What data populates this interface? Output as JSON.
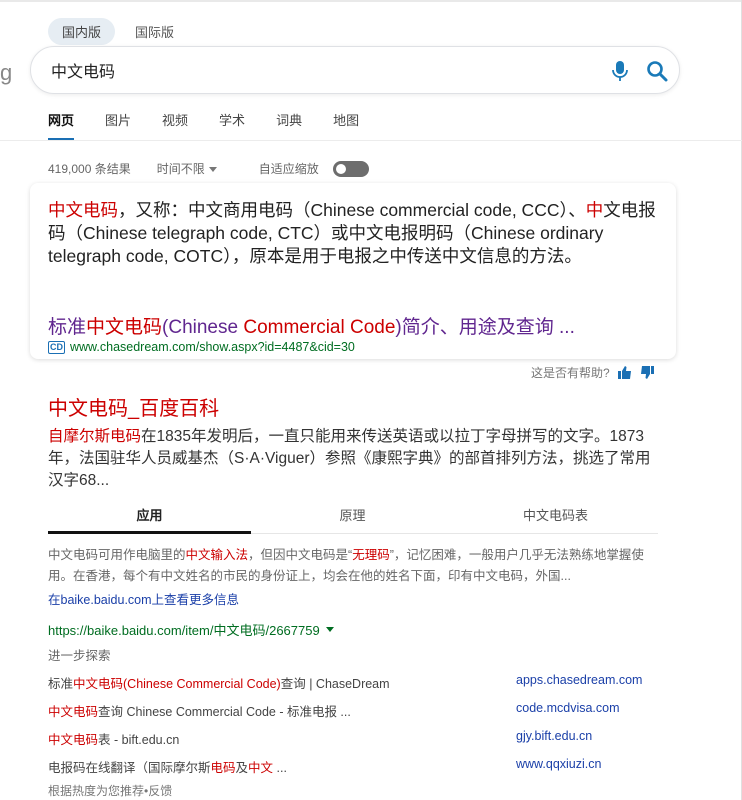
{
  "scope_tabs": [
    "国内版",
    "国际版"
  ],
  "logo_fragment": "g",
  "search": {
    "query": "中文电码"
  },
  "nav": [
    "网页",
    "图片",
    "视频",
    "学术",
    "词典",
    "地图"
  ],
  "filters": {
    "count": "419,000 条结果",
    "time": "时间不限",
    "toggle_label": "自适应缩放"
  },
  "answer": {
    "term": "中文电码",
    "text_part1": "，又称：中文商用电码（Chinese commercial code, CCC）、",
    "hl_char": "中",
    "text_part2": "文电报码（Chinese telegraph code, CTC）或中文电报明码（Chinese ordinary telegraph code, COTC），原本是用于电报之中传送中文信息的方法。",
    "link_prefix": "标准",
    "link_hl1": "中文电码",
    "link_mid": "(Chinese ",
    "link_hl2": "Commercial Code",
    "link_suffix": ")简介、用途及查询 ...",
    "source_icon": "CD",
    "source": "www.chasedream.com/show.aspx?id=4487&cid=30"
  },
  "feedback": {
    "label": "这是否有帮助?",
    "up_icon": "thumbs-up-icon",
    "down_icon": "thumbs-down-icon"
  },
  "result2": {
    "title_hl": "中文电码",
    "title_rest": "_百度百科",
    "snippet_hl": "自摩尔斯电码",
    "snippet_rest": "在1835年发明后，一直只能用来传送英语或以拉丁字母拼写的文字。1873年，法国驻华人员威基杰（S·A·Viguer）参照《康熙字典》的部首排列方法，挑选了常用汉字68...",
    "tabs": [
      "应用",
      "原理",
      "中文电码表"
    ],
    "desc_p1": "中文电码可用作电脑里的",
    "desc_hl1": "中文输入法",
    "desc_p2": "，但因中文电码是“",
    "desc_hl2": "无理码",
    "desc_p3": "”，记忆困难，一般用户几乎无法熟练地掌握使用。在香港，每个有中文姓名的市民的身份证上，均会在他的姓名下面，印有中文电码，外国...",
    "more_info": "在baike.baidu.com上查看更多信息",
    "url": "https://baike.baidu.com/item/中文电码/2667759"
  },
  "explore": {
    "title": "进一步探索",
    "rows": [
      {
        "a": "标准",
        "b": "中文电码(Chinese Commercial Code)",
        "c": "查询 | ChaseDream",
        "d": "",
        "e": "",
        "site": "apps.chasedream.com"
      },
      {
        "a": "",
        "b": "中文电码",
        "c": "查询 Chinese Commercial Code - 标准电报 ...",
        "d": "",
        "e": "",
        "site": "code.mcdvisa.com"
      },
      {
        "a": "",
        "b": "中文电码",
        "c": "表 - bift.edu.cn",
        "d": "",
        "e": "",
        "site": "gjy.bift.edu.cn"
      },
      {
        "a": "电报码在线翻译（国际摩尔斯",
        "b": "电码",
        "c": "及",
        "d": "中文",
        "e": " ...",
        "site": "www.qqxiuzi.cn"
      }
    ],
    "footer": "根据热度为您推荐•反馈"
  }
}
